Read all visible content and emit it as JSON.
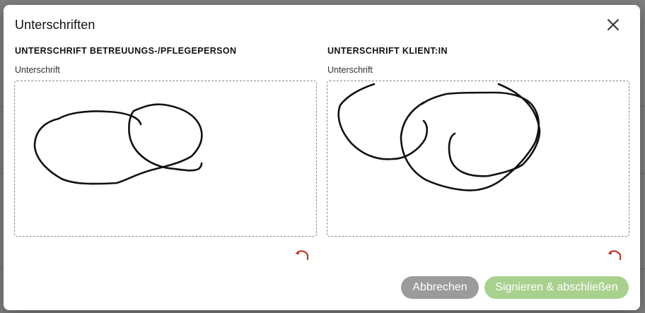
{
  "dialog": {
    "title": "Unterschriften",
    "close_icon": "close-icon"
  },
  "signatures": {
    "caregiver": {
      "heading": "UNTERSCHRIFT BETREUUNGS-/PFLEGEPERSON",
      "field_label": "Unterschrift",
      "undo_icon": "undo-icon"
    },
    "client": {
      "heading": "UNTERSCHRIFT KLIENT:IN",
      "field_label": "Unterschrift",
      "undo_icon": "undo-icon"
    }
  },
  "actions": {
    "cancel_label": "Abbrechen",
    "sign_label": "Signieren & abschließen"
  },
  "colors": {
    "cancel_button": "#9b9b9b",
    "sign_button": "#a9d18e",
    "undo_icon": "#c0392b",
    "stroke": "#111111"
  }
}
